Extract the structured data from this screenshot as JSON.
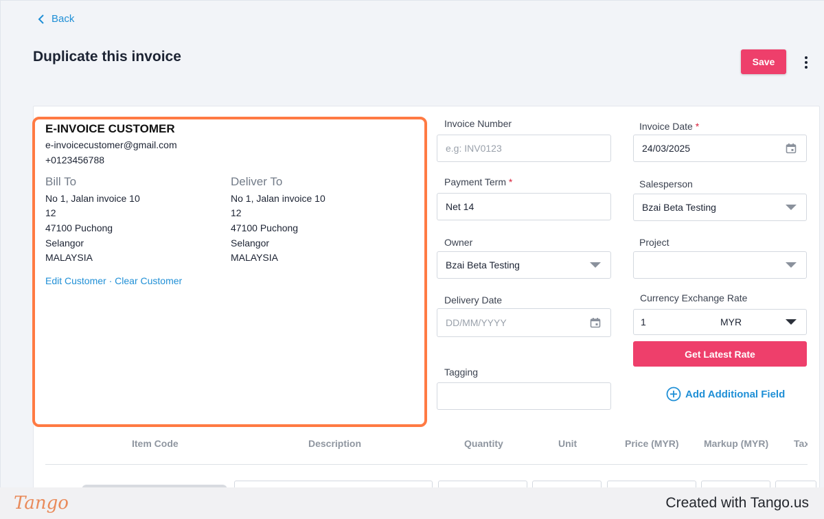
{
  "nav": {
    "back_label": "Back"
  },
  "header": {
    "title": "Duplicate this invoice",
    "save_label": "Save"
  },
  "customer": {
    "name": "E-INVOICE CUSTOMER",
    "email": "e-invoicecustomer@gmail.com",
    "phone": "+0123456788",
    "bill_to": {
      "heading": "Bill To",
      "lines": [
        "No 1, Jalan invoice 10",
        "12",
        "47100 Puchong",
        "Selangor",
        "MALAYSIA"
      ]
    },
    "deliver_to": {
      "heading": "Deliver To",
      "lines": [
        "No 1, Jalan invoice 10",
        "12",
        "47100 Puchong",
        "Selangor",
        "MALAYSIA"
      ]
    },
    "edit_label": "Edit Customer",
    "separator": " · ",
    "clear_label": "Clear Customer"
  },
  "form": {
    "invoice_number": {
      "label": "Invoice Number",
      "placeholder": "e.g: INV0123",
      "value": ""
    },
    "invoice_date": {
      "label": "Invoice Date",
      "required": "*",
      "value": "24/03/2025"
    },
    "payment_term": {
      "label": "Payment Term",
      "required": "*",
      "value": "Net 14"
    },
    "salesperson": {
      "label": "Salesperson",
      "value": "Bzai Beta Testing"
    },
    "owner": {
      "label": "Owner",
      "value": "Bzai Beta Testing"
    },
    "project": {
      "label": "Project",
      "value": ""
    },
    "delivery_date": {
      "label": "Delivery Date",
      "placeholder": "DD/MM/YYYY",
      "value": ""
    },
    "currency_rate": {
      "label": "Currency Exchange Rate",
      "value": "1",
      "currency": "MYR"
    },
    "get_rate_label": "Get Latest Rate",
    "tagging": {
      "label": "Tagging",
      "value": ""
    },
    "add_field_label": "Add Additional Field"
  },
  "items_table": {
    "columns": [
      "Item Code",
      "Description",
      "Quantity",
      "Unit",
      "Price (MYR)",
      "Markup (MYR)",
      "Tax"
    ]
  },
  "footer": {
    "logo_text": "Tango",
    "credit": "Created with Tango.us"
  },
  "colors": {
    "accent": "#ee3f6b",
    "link": "#1f8fd6",
    "highlight": "#ff7a43"
  }
}
